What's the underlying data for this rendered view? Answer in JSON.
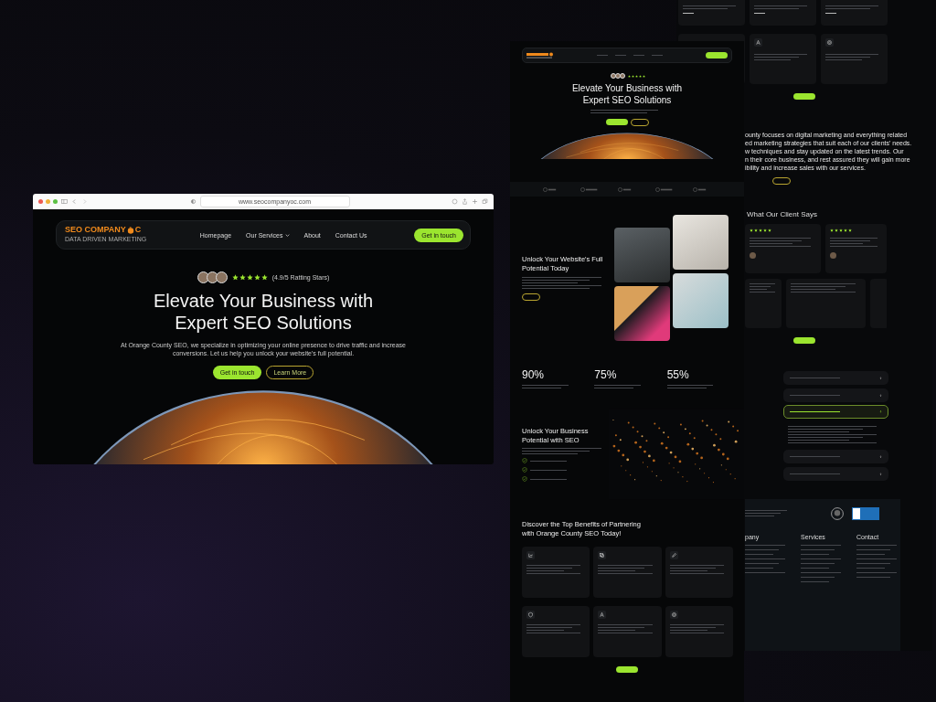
{
  "browser": {
    "url": "www.seocompanyoc.com"
  },
  "desktop_page": {
    "logo": {
      "name": "SEO COMPANY",
      "letter": "C",
      "tagline": "DATA DRIVEN MARKETING"
    },
    "nav": [
      {
        "label": "Homepage",
        "dropdown": false
      },
      {
        "label": "Our Services",
        "dropdown": true
      },
      {
        "label": "About",
        "dropdown": false
      },
      {
        "label": "Contact Us",
        "dropdown": false
      }
    ],
    "nav_button": "Get in touch",
    "hero": {
      "stars": 5,
      "rating": "(4.9/5 Ratting Stars)",
      "heading_lines": [
        "Elevate Your Business with",
        "Expert SEO Solutions"
      ],
      "text": "At Orange County SEO, we specialize in optimizing your online presence to drive traffic and increase conversions. Let us help you unlock your website's full potential.",
      "primary_button": "Get in touch",
      "secondary_button": "Learn More"
    }
  },
  "long_page": {
    "hero": {
      "stars": 5,
      "heading_lines": [
        "Elevate Your Business with",
        "Expert SEO Solutions"
      ]
    },
    "unlock": {
      "heading_lines": [
        "Unlock Your Website's Full",
        "Potential Today"
      ]
    },
    "stats": [
      {
        "value": "90%"
      },
      {
        "value": "75%"
      },
      {
        "value": "55%"
      }
    ],
    "features": {
      "heading_lines": [
        "Unlock Your Business",
        "Potential with SEO"
      ]
    },
    "benefits": {
      "heading_lines": [
        "Discover the Top Benefits of Partnering",
        "with Orange County SEO Today!"
      ]
    }
  },
  "side_page": {
    "about_lines": [
      "ounty focuses on digital marketing and everything related",
      "ed marketing strategies that suit each of our clients' needs.",
      "w techniques and stay updated on the latest trends. Our",
      "n their core business, and rest assured they will gain more",
      "ibility and increase sales with our services."
    ],
    "testimonials_heading": "What Our Client Says",
    "testimonials": [
      {
        "stars": 5
      },
      {
        "stars": 5
      }
    ],
    "faq": [
      {
        "expanded": false
      },
      {
        "expanded": false
      },
      {
        "expanded": true
      },
      {
        "expanded": false
      },
      {
        "expanded": false
      }
    ],
    "footer": {
      "column_titles": [
        "pany",
        "Services",
        "Contact"
      ]
    }
  }
}
